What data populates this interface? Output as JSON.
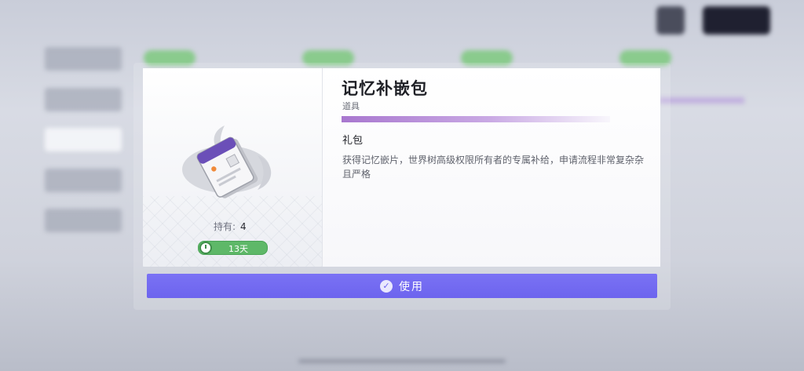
{
  "item": {
    "name": "记忆补嵌包",
    "category": "道具",
    "type": "礼包",
    "description": "获得记忆嵌片，世界树高级权限所有者的专属补给，申请流程非常复杂杂且严格",
    "owned_label": "持有:",
    "owned_count": "4",
    "expiry": "13天",
    "rarity_color": "#a877cf"
  },
  "actions": {
    "use_label": "使用",
    "accent": "#6d64ee"
  },
  "icons": {
    "item": "memory-chip-pack-icon",
    "timer": "clock-icon",
    "use": "check-circle-icon"
  }
}
